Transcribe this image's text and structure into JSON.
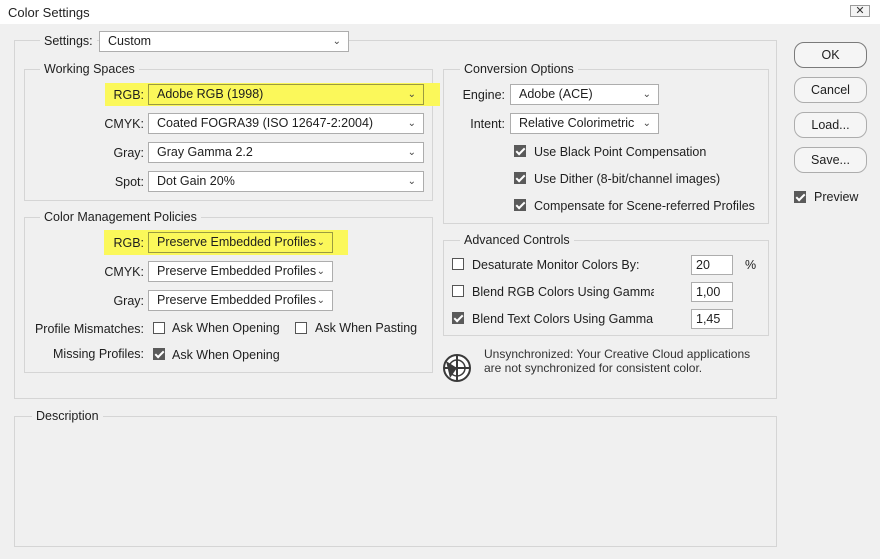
{
  "window": {
    "title": "Color Settings",
    "close": "✕"
  },
  "settings": {
    "label": "Settings:",
    "value": "Custom"
  },
  "working_spaces": {
    "legend": "Working Spaces",
    "rgb": {
      "label": "RGB:",
      "value": "Adobe RGB (1998)"
    },
    "cmyk": {
      "label": "CMYK:",
      "value": "Coated FOGRA39 (ISO 12647-2:2004)"
    },
    "gray": {
      "label": "Gray:",
      "value": "Gray Gamma 2.2"
    },
    "spot": {
      "label": "Spot:",
      "value": "Dot Gain 20%"
    }
  },
  "policies": {
    "legend": "Color Management Policies",
    "rgb": {
      "label": "RGB:",
      "value": "Preserve Embedded Profiles"
    },
    "cmyk": {
      "label": "CMYK:",
      "value": "Preserve Embedded Profiles"
    },
    "gray": {
      "label": "Gray:",
      "value": "Preserve Embedded Profiles"
    },
    "mismatch_label": "Profile Mismatches:",
    "ask_opening": {
      "label": "Ask When Opening",
      "checked": false
    },
    "ask_pasting": {
      "label": "Ask When Pasting",
      "checked": false
    },
    "missing_label": "Missing Profiles:",
    "missing_ask_opening": {
      "label": "Ask When Opening",
      "checked": true
    }
  },
  "conversion": {
    "legend": "Conversion Options",
    "engine": {
      "label": "Engine:",
      "value": "Adobe (ACE)"
    },
    "intent": {
      "label": "Intent:",
      "value": "Relative Colorimetric"
    },
    "black_point": {
      "label": "Use Black Point Compensation",
      "checked": true
    },
    "dither": {
      "label": "Use Dither (8-bit/channel images)",
      "checked": true
    },
    "scene_referred": {
      "label": "Compensate for Scene-referred Profiles",
      "checked": true
    }
  },
  "advanced": {
    "legend": "Advanced Controls",
    "desaturate": {
      "label": "Desaturate Monitor Colors By:",
      "value": "20",
      "unit": "%",
      "checked": false
    },
    "blend_rgb": {
      "label": "Blend RGB Colors Using Gamma:",
      "value": "1,00",
      "checked": false
    },
    "blend_text": {
      "label": "Blend Text Colors Using Gamma:",
      "value": "1,45",
      "checked": true
    }
  },
  "sync": {
    "icon": "sync-status-icon",
    "line1": "Unsynchronized: Your Creative Cloud applications",
    "line2": "are not synchronized for consistent color."
  },
  "description": {
    "legend": "Description"
  },
  "buttons": {
    "ok": "OK",
    "cancel": "Cancel",
    "load": "Load...",
    "save": "Save..."
  },
  "preview": {
    "label": "Preview",
    "checked": true
  },
  "colors": {
    "highlight": "#fbf85a",
    "dialog_bg": "#f0f0f0",
    "border": "#d5d5d5"
  }
}
